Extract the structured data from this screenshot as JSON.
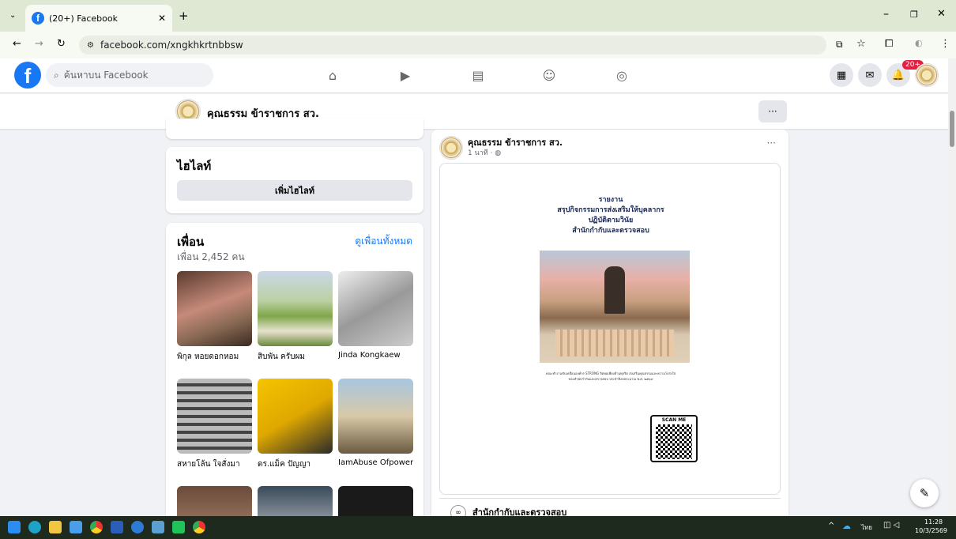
{
  "browser": {
    "tab_title": "(20+) Facebook",
    "url": "facebook.com/xngkhkrtnbbsw"
  },
  "fb": {
    "logo": "f",
    "search_placeholder": "ค้นหาบน Facebook",
    "notif_badge": "20+"
  },
  "page": {
    "name": "คุณธรรม ข้าราชการ สว.",
    "more": "···"
  },
  "highlights": {
    "title": "ไฮไลท์",
    "button": "เพิ่มไฮไลท์"
  },
  "friends": {
    "title": "เพื่อน",
    "see_all": "ดูเพื่อนทั้งหมด",
    "count": "เพื่อน 2,452 คน",
    "items": [
      {
        "name": "พิกุล หอยดอกหอม"
      },
      {
        "name": "สิบพัน ครับผม"
      },
      {
        "name": "Jinda Kongkaew"
      },
      {
        "name": "สหายโล้น ใจสั่งมา"
      },
      {
        "name": "ดร.แม็ค ปัญญา"
      },
      {
        "name": "IamAbuse Ofpower"
      }
    ]
  },
  "post": {
    "author": "คุณธรรม ข้าราชการ สว.",
    "time": "1 นาที · ◍",
    "more": "···",
    "doc_title_lines": [
      "รายงาน",
      "สรุปกิจกรรมการส่งเสริมให้บุคลากร",
      "ปฏิบัติตามวินัย",
      "สำนักกำกับและตรวจสอบ"
    ],
    "doc_caption_1": "คณะทำงานขับเคลื่อนองค์กร STRONG จิตพอเพียงต้านทุจริต ส่งเสริมคุณธรรมและความโปร่งใส",
    "doc_caption_2": "ของสำนักกำกับและตรวจสอบ ประจำปีงบประมาณ พ.ศ. ๒๕๖๙",
    "scan": "SCAN ME",
    "shared_from": "สำนักกำกับและตรวจสอบ"
  },
  "taskbar": {
    "time": "11:28",
    "date": "10/3/2569",
    "lang": "ไทย"
  },
  "colors": {
    "fb_blue": "#1877f2",
    "tab_bg": "#dfe8d2"
  }
}
